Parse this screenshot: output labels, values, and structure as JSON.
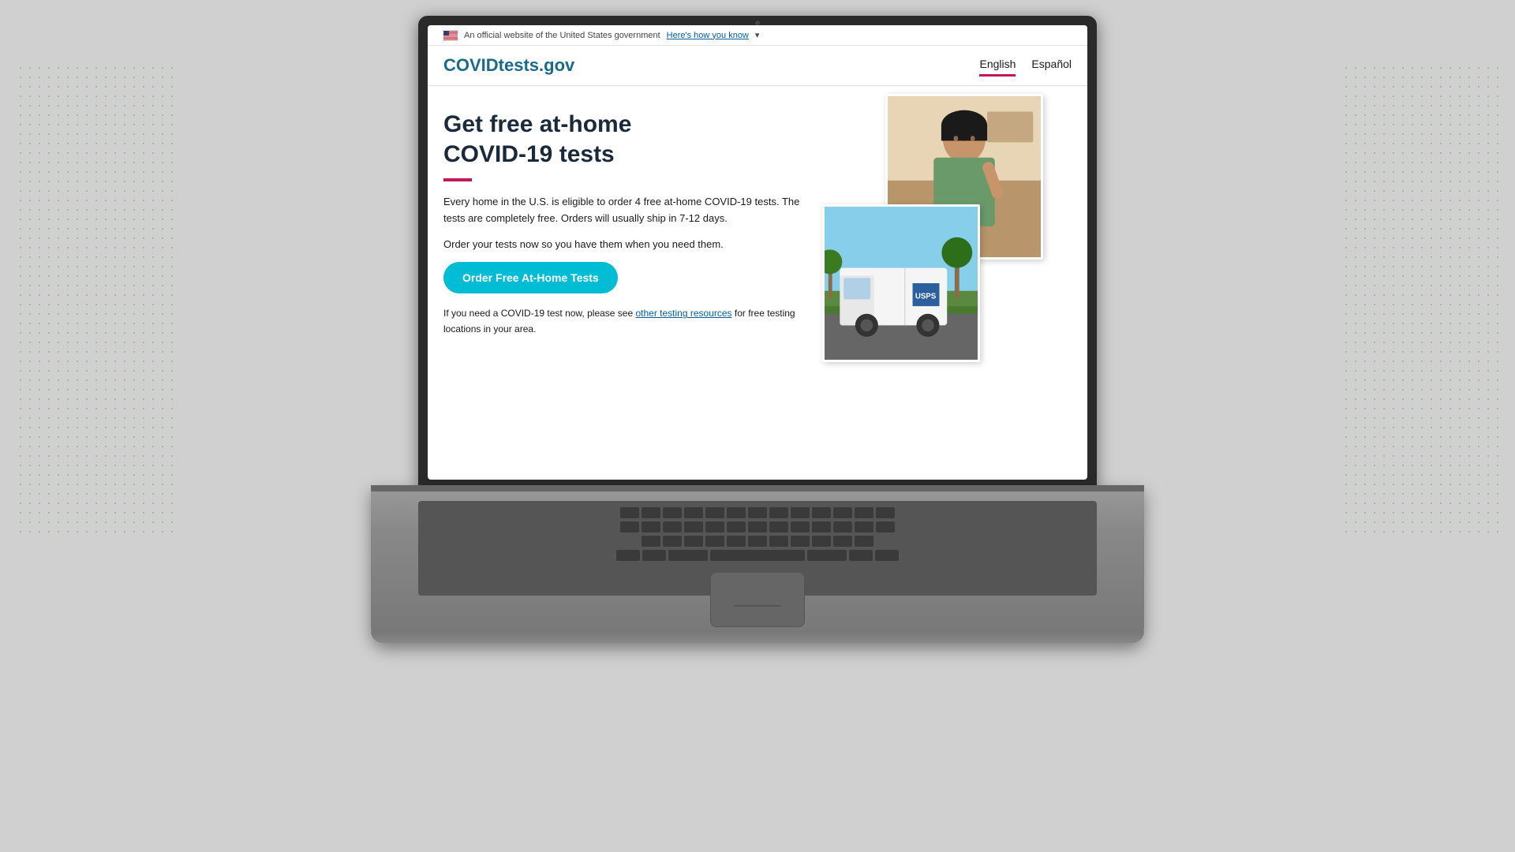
{
  "background": {
    "color": "#c8c8c8"
  },
  "website": {
    "gov_banner": {
      "flag_alt": "US Flag",
      "official_text": "An official website of the United States government",
      "heres_how_link": "Here's how you know"
    },
    "header": {
      "site_title": "COVIDtests.gov",
      "lang_english": "English",
      "lang_espanol": "Español"
    },
    "main": {
      "heading_line1": "Get free at-home",
      "heading_line2": "COVID-19 tests",
      "paragraph1": "Every home in the U.S. is eligible to order 4 free at-home COVID-19 tests. The tests are completely free. Orders will usually ship in 7-12 days.",
      "paragraph2": "Order your tests now so you have them when you need them.",
      "cta_button": "Order Free At-Home Tests",
      "footer_text_before": "If you need a COVID-19 test now, please see ",
      "footer_link_text": "other testing resources",
      "footer_text_after": " for free testing locations in your area."
    }
  }
}
